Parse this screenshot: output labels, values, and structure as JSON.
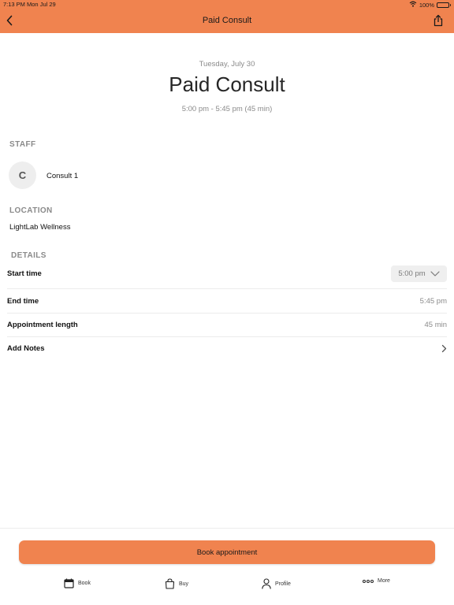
{
  "status_bar": {
    "time": "7:13 PM  Mon Jul 29",
    "battery": "100%"
  },
  "nav": {
    "title": "Paid Consult"
  },
  "appointment": {
    "date": "Tuesday, July 30",
    "title": "Paid Consult",
    "time_range": "5:00 pm - 5:45 pm (45 min)"
  },
  "staff": {
    "label": "STAFF",
    "avatar_initial": "C",
    "name": "Consult 1"
  },
  "location": {
    "label": "LOCATION",
    "name": "LightLab Wellness"
  },
  "details": {
    "label": "DETAILS",
    "start_time_label": "Start time",
    "start_time_value": "5:00 pm",
    "end_time_label": "End time",
    "end_time_value": "5:45 pm",
    "length_label": "Appointment length",
    "length_value": "45 min",
    "notes_label": "Add Notes"
  },
  "actions": {
    "book_label": "Book appointment"
  },
  "tabbar": {
    "book": "Book",
    "buy": "Buy",
    "profile": "Profile",
    "more": "More"
  },
  "colors": {
    "accent": "#f0834f",
    "muted_text": "#8a8a8a"
  },
  "icons": [
    "wifi-icon",
    "battery-icon",
    "back-chevron-icon",
    "share-icon",
    "chevron-down-icon",
    "chevron-right-icon",
    "calendar-icon",
    "shopping-bag-icon",
    "person-icon",
    "more-dots-icon"
  ]
}
